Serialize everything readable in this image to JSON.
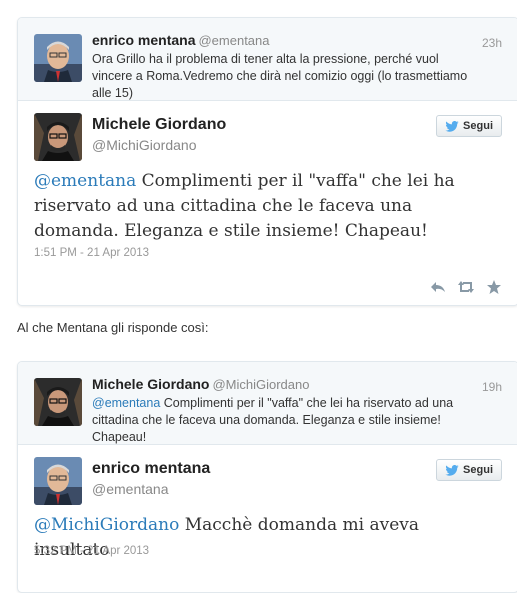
{
  "tweet1": {
    "reply": {
      "name": "enrico mentana",
      "handle": "@ementana",
      "time": "23h",
      "text": "Ora Grillo ha il problema di tener alta la pressione, perché vuol vincere a Roma.Vedremo che dirà nel comizio oggi (lo trasmettiamo alle 15)"
    },
    "main": {
      "name": "Michele Giordano",
      "handle": "@MichiGiordano",
      "follow_label": "Segui",
      "mention": "@ementana",
      "text": " Complimenti per il \"vaffa\" che lei ha riservato ad una cittadina che le faceva una domanda. Eleganza e stile insieme! Chapeau!",
      "date": "1:51 PM - 21 Apr 2013"
    },
    "actions": [
      "reply-icon",
      "retweet-icon",
      "favorite-icon"
    ]
  },
  "between_text": "Al che Mentana gli risponde così:",
  "tweet2": {
    "reply": {
      "name": "Michele Giordano",
      "handle": "@MichiGiordano",
      "time": "19h",
      "mention": "@ementana",
      "text": " Complimenti per il \"vaffa\" che lei ha riservato ad una cittadina che le faceva una domanda. Eleganza e stile insieme! Chapeau!"
    },
    "main": {
      "name": "enrico mentana",
      "handle": "@ementana",
      "follow_label": "Segui",
      "mention": "@MichiGiordano",
      "text": " Macchè domanda mi aveva insultato",
      "date": "5:32 PM - 21 Apr 2013"
    }
  },
  "colors": {
    "link": "#2b7bb9",
    "muted": "#999999",
    "border": "#e1e8ed",
    "twitter_blue": "#55acee"
  }
}
